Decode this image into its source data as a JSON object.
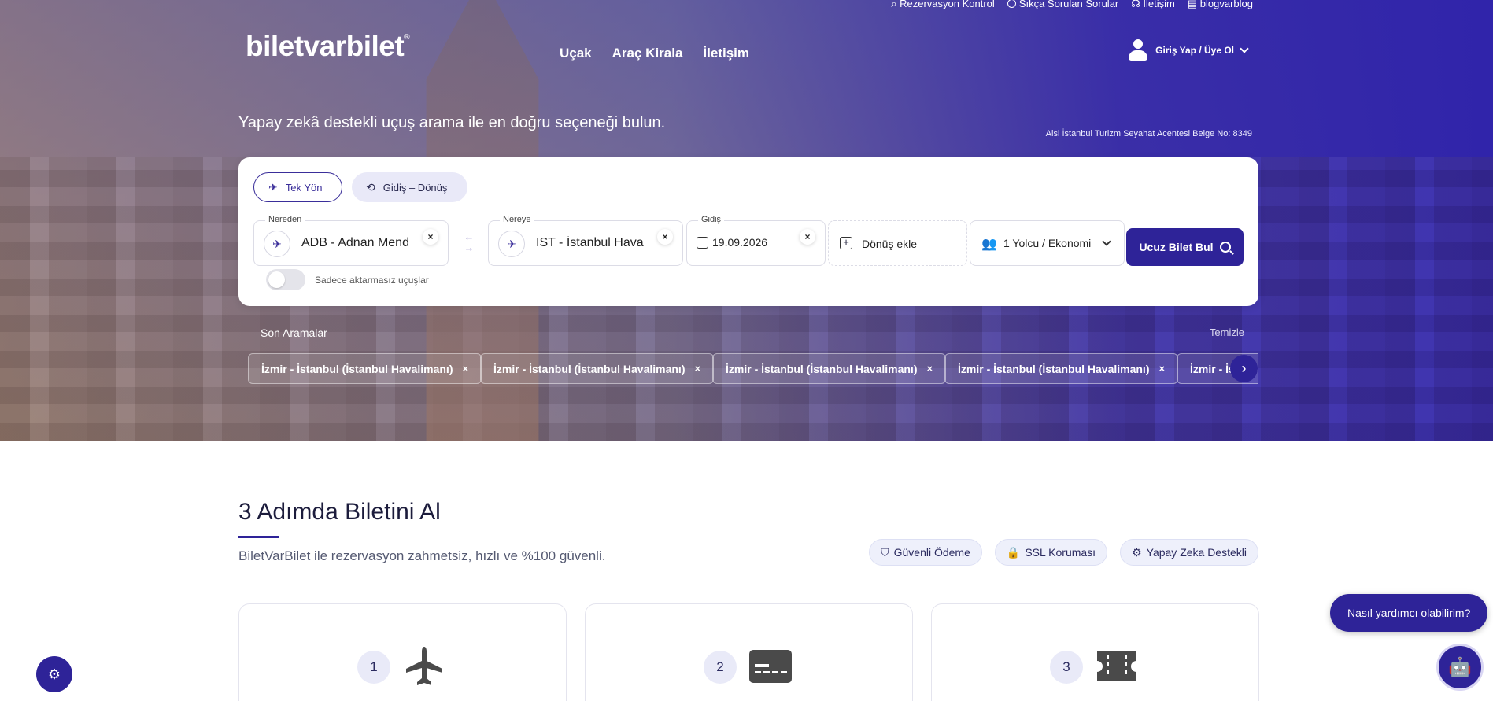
{
  "top_links": [
    {
      "label": "Rezervasyon Kontrol",
      "icon": "search-icon"
    },
    {
      "label": "Sıkça Sorulan Sorular",
      "icon": "info-icon"
    },
    {
      "label": "İletişim",
      "icon": "headset-icon"
    },
    {
      "label": "blogvarblog",
      "icon": "document-icon"
    }
  ],
  "logo": {
    "text": "biletvarbilet",
    "mark": "®"
  },
  "nav": [
    "Uçak",
    "Araç Kirala",
    "İletişim"
  ],
  "login": {
    "label": "Giriş Yap / Üye Ol"
  },
  "hero": {
    "tagline": "Yapay zekâ destekli uçuş arama ile en doğru seçeneği bulun.",
    "license": "Aisi İstanbul Turizm Seyahat Acentesi Belge No: 8349"
  },
  "search": {
    "trip_one": "Tek Yön",
    "trip_round": "Gidiş – Dönüş",
    "from_label": "Nereden",
    "from_value": "ADB - Adnan Mend",
    "to_label": "Nereye",
    "to_value": "IST - İstanbul Hava",
    "date_label": "Gidiş",
    "date_value": "19.09.2026",
    "return_label": "Dönüş ekle",
    "passengers": "1 Yolcu / Ekonomi",
    "button": "Ucuz Bilet Bul",
    "direct_only": "Sadece aktarmasız uçuşlar",
    "clear_symbol": "×"
  },
  "recent": {
    "title": "Son Aramalar",
    "clear": "Temizle",
    "items": [
      "İzmir - İstanbul (İstanbul Havalimanı)",
      "İzmir - İstanbul (İstanbul Havalimanı)",
      "İzmir - İstanbul (İstanbul Havalimanı)",
      "İzmir - İstanbul (İstanbul Havalimanı)",
      "İzmir - İstanbul (İstanbul Havalimanı)"
    ],
    "remove_symbol": "×",
    "next_symbol": "›"
  },
  "steps_section": {
    "title": "3 Adımda Biletini Al",
    "subtitle": "BiletVarBilet ile rezervasyon zahmetsiz, hızlı ve %100 güvenli.",
    "badges": [
      {
        "label": "Güvenli Ödeme",
        "icon": "shield-icon"
      },
      {
        "label": "SSL Koruması",
        "icon": "lock-icon"
      },
      {
        "label": "Yapay Zeka Destekli",
        "icon": "robot-icon"
      }
    ],
    "steps": [
      {
        "number": "1",
        "icon": "airplane-icon"
      },
      {
        "number": "2",
        "icon": "credit-card-icon"
      },
      {
        "number": "3",
        "icon": "ticket-icon"
      }
    ]
  },
  "assistant": {
    "bubble": "Nasıl yardımcı olabilirim?"
  },
  "colors": {
    "brand": "#2e2398",
    "accent_light": "#e9eaf8"
  }
}
